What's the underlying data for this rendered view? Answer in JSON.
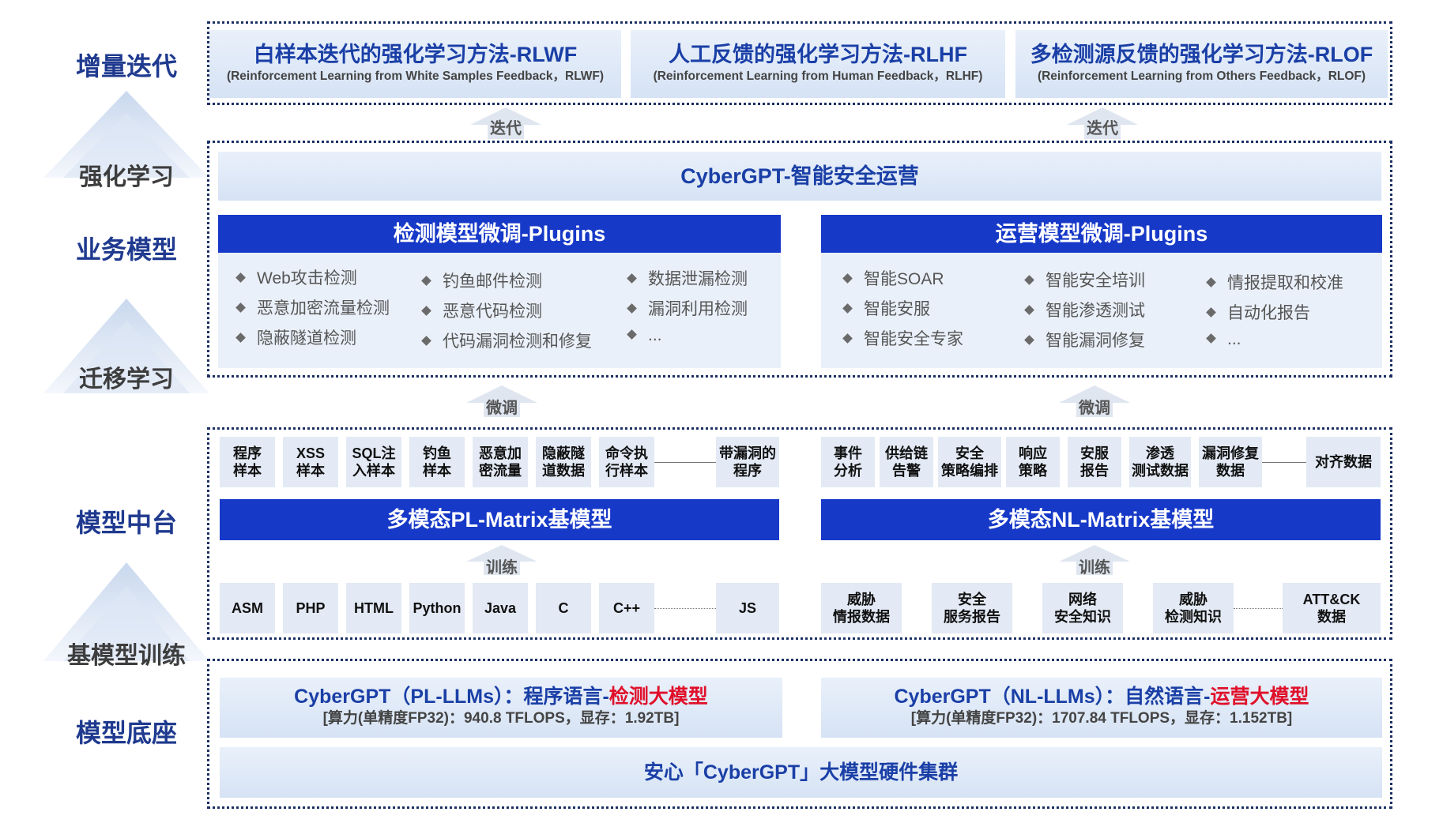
{
  "side_labels": {
    "l1": "增量迭代",
    "l2": "强化学习",
    "l3": "业务模型",
    "l4": "迁移学习",
    "l5": "模型中台",
    "l6": "基模型训练",
    "l7": "模型底座"
  },
  "rl_methods": [
    {
      "title": "白样本迭代的强化学习方法-RLWF",
      "subtitle": "(Reinforcement Learning from White Samples Feedback，RLWF)"
    },
    {
      "title": "人工反馈的强化学习方法-RLHF",
      "subtitle": "(Reinforcement Learning from Human Feedback，RLHF)"
    },
    {
      "title": "多检测源反馈的强化学习方法-RLOF",
      "subtitle": "(Reinforcement Learning from Others Feedback，RLOF)"
    }
  ],
  "arrows": {
    "iterate_left": "迭代",
    "iterate_right": "迭代",
    "finetune_left": "微调",
    "finetune_right": "微调",
    "train_left": "训练",
    "train_right": "训练"
  },
  "business": {
    "title": "CyberGPT-智能安全运营",
    "detect": {
      "header": "检测模型微调-Plugins",
      "items": [
        "Web攻击检测",
        "恶意加密流量检测",
        "隐蔽隧道检测",
        "钓鱼邮件检测",
        "恶意代码检测",
        "代码漏洞检测和修复",
        "数据泄漏检测",
        "漏洞利用检测",
        "..."
      ]
    },
    "ops": {
      "header": "运营模型微调-Plugins",
      "items": [
        "智能SOAR",
        "智能安服",
        "智能安全专家",
        "智能安全培训",
        "智能渗透测试",
        "智能漏洞修复",
        "情报提取和校准",
        "自动化报告",
        "..."
      ]
    }
  },
  "platform": {
    "pl_samples": [
      "程序\n样本",
      "XSS\n样本",
      "SQL注\n入样本",
      "钓鱼\n样本",
      "恶意加\n密流量",
      "隐蔽隧\n道数据",
      "命令执\n行样本",
      "带漏洞的\n程序"
    ],
    "nl_samples": [
      "事件\n分析",
      "供给链\n告警",
      "安全\n策略编排",
      "响应\n策略",
      "安服\n报告",
      "渗透\n测试数据",
      "漏洞修复\n数据",
      "对齐数据"
    ],
    "pl_model": "多模态PL-Matrix基模型",
    "nl_model": "多模态NL-Matrix基模型",
    "pl_langs": [
      "ASM",
      "PHP",
      "HTML",
      "Python",
      "Java",
      "C",
      "C++",
      "JS"
    ],
    "nl_data": [
      "威胁\n情报数据",
      "安全\n服务报告",
      "网络\n安全知识",
      "威胁\n检测知识",
      "ATT&CK\n数据"
    ]
  },
  "base": {
    "pl_title_a": "CyberGPT（PL-LLMs）：程序语言-",
    "pl_title_b": "检测大模型",
    "pl_spec": "[算力(单精度FP32)：940.8 TFLOPS，显存：1.92TB]",
    "nl_title_a": "CyberGPT（NL-LLMs）：自然语言-",
    "nl_title_b": "运营大模型",
    "nl_spec": "[算力(单精度FP32)：1707.84 TFLOPS，显存：1.152TB]",
    "cluster": "安心「CyberGPT」大模型硬件集群"
  },
  "colors": {
    "accent": "#1739c8",
    "title_blue": "#1a3fa6",
    "red": "#e0102a",
    "border": "#1b2f63"
  }
}
